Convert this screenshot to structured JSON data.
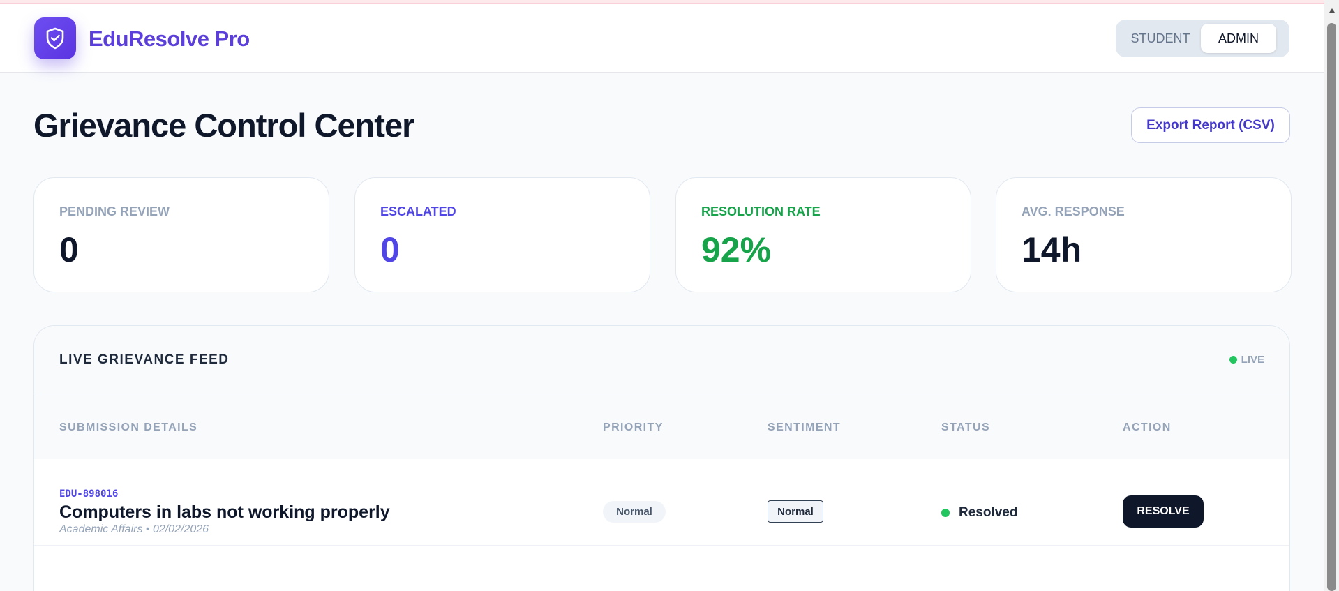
{
  "app": {
    "brand": "EduResolve Pro",
    "accent_color": "#5b3fd8",
    "logo_icon": "shield-check-icon"
  },
  "role_toggle": {
    "options": [
      "STUDENT",
      "ADMIN"
    ],
    "selected": "ADMIN"
  },
  "page": {
    "title": "Grievance Control Center",
    "export_label": "Export Report (CSV)"
  },
  "stats": [
    {
      "label": "PENDING REVIEW",
      "value": "0",
      "label_color": "#94a3b8",
      "value_color": "#0f172a"
    },
    {
      "label": "ESCALATED",
      "value": "0",
      "label_color": "#4f46e5",
      "value_color": "#4f46e5"
    },
    {
      "label": "RESOLUTION RATE",
      "value": "92%",
      "label_color": "#16a34a",
      "value_color": "#16a34a"
    },
    {
      "label": "AVG. RESPONSE",
      "value": "14h",
      "label_color": "#94a3b8",
      "value_color": "#0f172a"
    }
  ],
  "feed": {
    "title": "LIVE GRIEVANCE FEED",
    "live_label": "LIVE",
    "columns": [
      "SUBMISSION DETAILS",
      "PRIORITY",
      "SENTIMENT",
      "STATUS",
      "ACTION"
    ],
    "rows": [
      {
        "id": "EDU-898016",
        "title": "Computers in labs not working properly",
        "meta": "Academic Affairs • 02/02/2026",
        "priority": "Normal",
        "sentiment": "Normal",
        "status": "Resolved",
        "status_color": "#22c55e",
        "action": "RESOLVE"
      }
    ]
  }
}
